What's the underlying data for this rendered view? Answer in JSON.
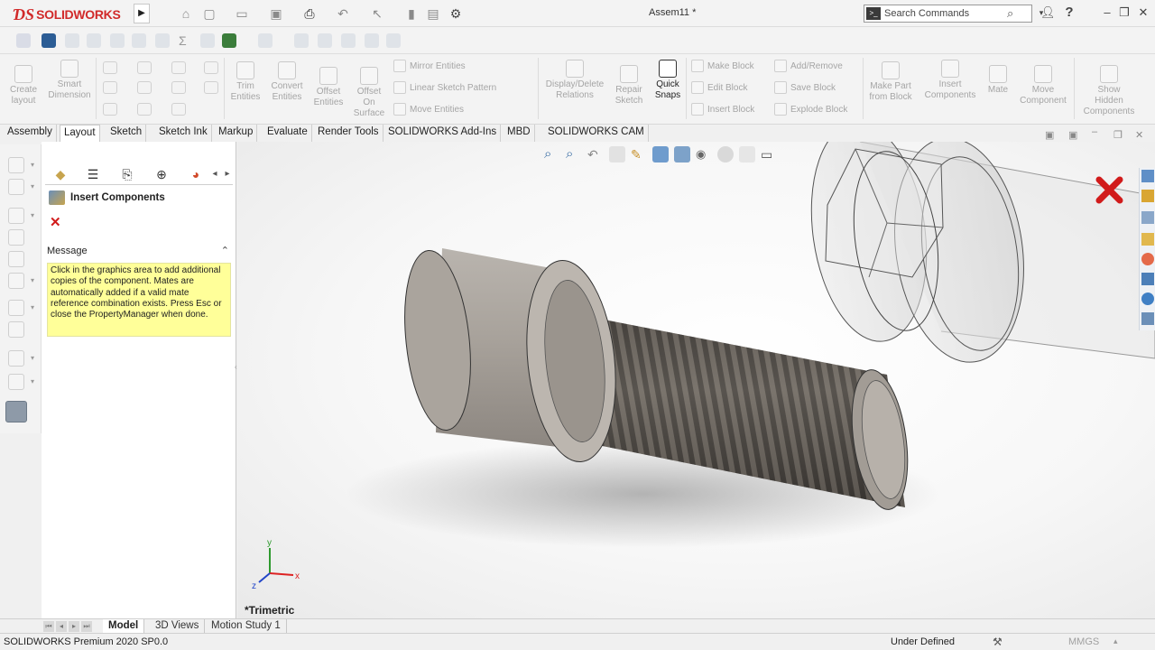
{
  "titlebar": {
    "app_name": "SOLIDWORKS",
    "document_title": "Assem11 *",
    "search_placeholder": "Search Commands",
    "help_label": "?",
    "minimize": "–",
    "restore": "❐",
    "close": "✕"
  },
  "command_manager": {
    "create_layout": "Create\nlayout",
    "smart_dimension": "Smart\nDimension",
    "trim_entities": "Trim\nEntities",
    "convert_entities": "Convert\nEntities",
    "offset_entities": "Offset\nEntities",
    "offset_on_surface": "Offset\nOn\nSurface",
    "mirror_entities": "Mirror Entities",
    "linear_sketch_pattern": "Linear Sketch Pattern",
    "move_entities": "Move Entities",
    "display_delete_relations": "Display/Delete\nRelations",
    "repair_sketch": "Repair\nSketch",
    "quick_snaps": "Quick\nSnaps",
    "make_block": "Make Block",
    "edit_block": "Edit Block",
    "insert_block": "Insert Block",
    "add_remove": "Add/Remove",
    "save_block": "Save Block",
    "explode_block": "Explode Block",
    "make_part_from_block": "Make Part\nfrom Block",
    "insert_components": "Insert\nComponents",
    "mate": "Mate",
    "move_component": "Move\nComponent",
    "show_hidden_components": "Show\nHidden\nComponents"
  },
  "tabs": [
    "Assembly",
    "Layout",
    "Sketch",
    "Sketch Ink",
    "Markup",
    "Evaluate",
    "Render Tools",
    "SOLIDWORKS Add-Ins",
    "MBD",
    "SOLIDWORKS CAM"
  ],
  "active_tab": "Layout",
  "property_manager": {
    "title": "Insert Components",
    "message_header": "Message",
    "message_text": "Click in the graphics area to add additional copies of the component. Mates are automatically added if a valid mate reference combination exists. Press Esc or close the PropertyManager when done."
  },
  "viewport": {
    "view_name": "*Trimetric",
    "triad": {
      "x": "x",
      "y": "y",
      "z": "z"
    }
  },
  "bottom_tabs": [
    "Model",
    "3D Views",
    "Motion Study 1"
  ],
  "active_bottom_tab": "Model",
  "statusbar": {
    "app_version": "SOLIDWORKS Premium 2020 SP0.0",
    "definition_state": "Under Defined",
    "units": "MMGS"
  },
  "colors": {
    "brand_red": "#d12a2a",
    "message_yellow": "#ffff99",
    "close_red": "#d11b1b"
  }
}
